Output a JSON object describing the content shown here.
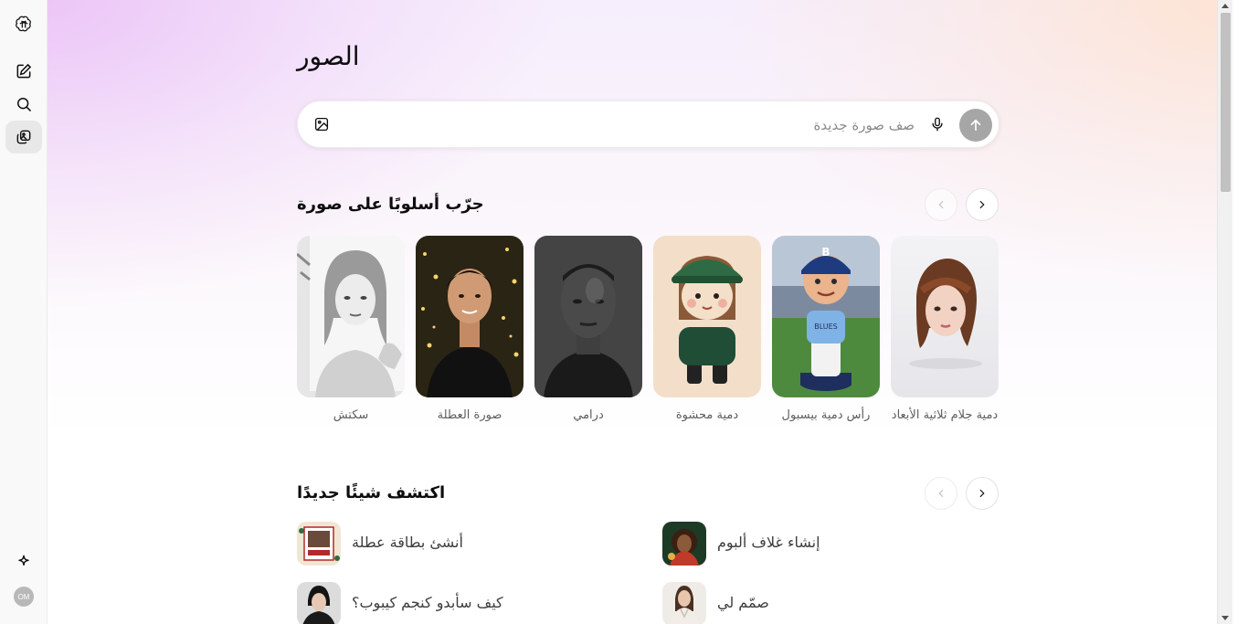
{
  "sidebar": {
    "items": [
      {
        "name": "logo",
        "icon": "openai-logo-icon"
      },
      {
        "name": "new-chat",
        "icon": "edit-icon"
      },
      {
        "name": "search",
        "icon": "search-icon"
      },
      {
        "name": "images",
        "icon": "images-icon",
        "active": true
      }
    ],
    "bottom_icon": "sparkle-icon",
    "avatar_initials": "OM"
  },
  "page": {
    "title": "الصور"
  },
  "composer": {
    "placeholder": "صف صورة جديدة",
    "value": ""
  },
  "styles_section": {
    "title": "جرّب أسلوبًا على صورة",
    "cards": [
      {
        "label": "دمية جلام ثلاثية الأبعاد"
      },
      {
        "label": "رأس دمية بيسبول"
      },
      {
        "label": "دمية محشوة"
      },
      {
        "label": "درامي"
      },
      {
        "label": "صورة العطلة"
      },
      {
        "label": "سكتش"
      }
    ]
  },
  "discover_section": {
    "title": "اكتشف شيئًا جديدًا",
    "items": [
      {
        "label": "إنشاء غلاف ألبوم"
      },
      {
        "label": "أنشئ بطاقة عطلة"
      },
      {
        "label": "صمّم لي"
      },
      {
        "label": "كيف سأبدو كنجم كيبوب؟"
      }
    ]
  },
  "colors": {
    "send_button": "#a6a6a6",
    "accent_pink": "#ecc6f7",
    "accent_peach": "#fde4d4"
  }
}
